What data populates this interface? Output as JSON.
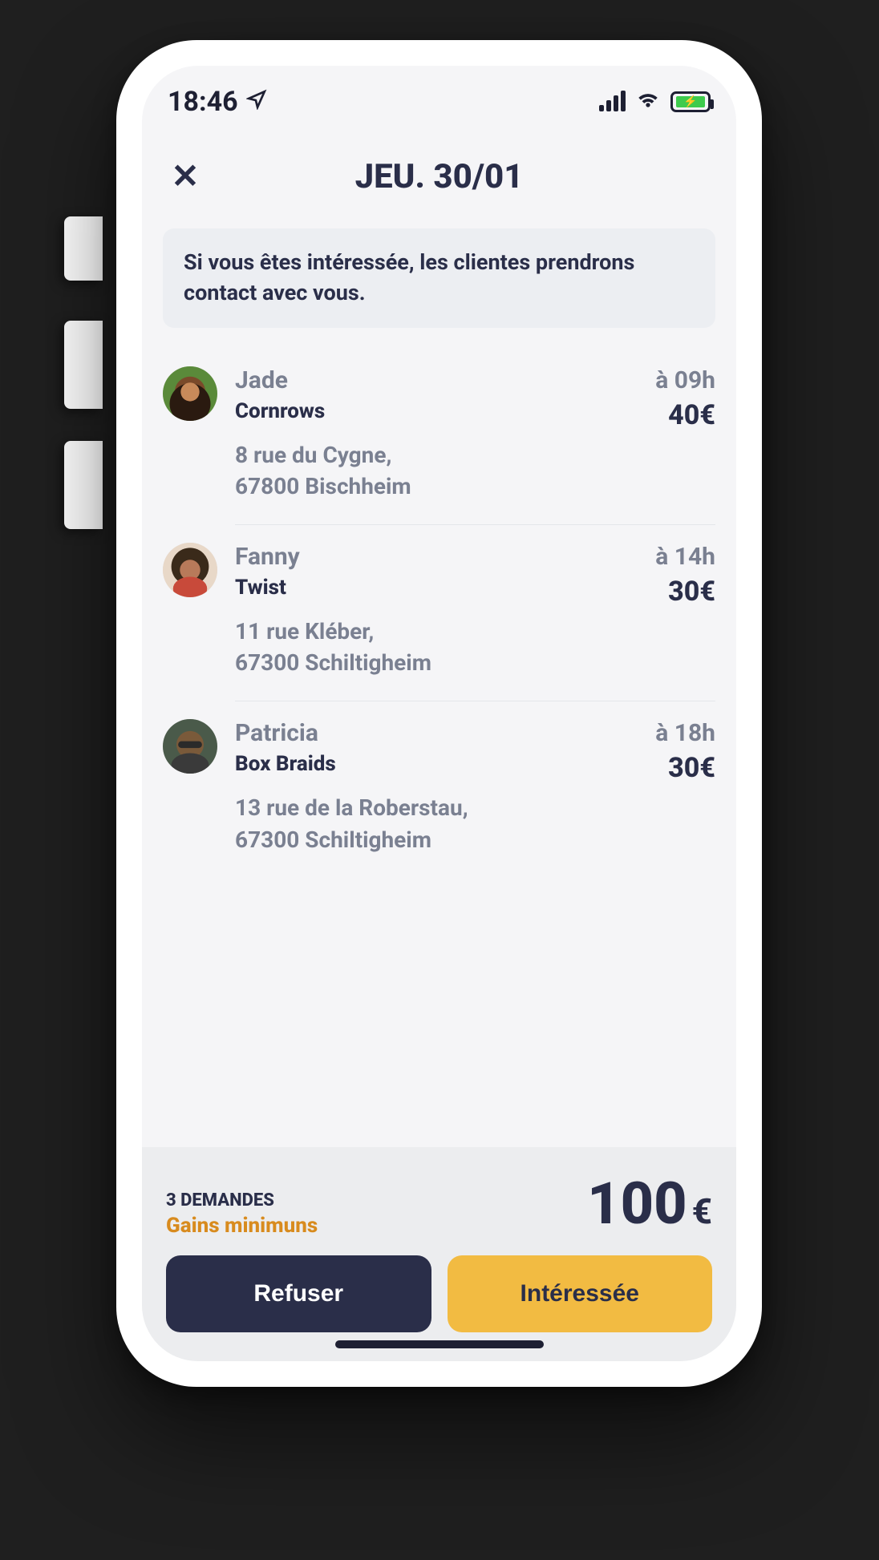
{
  "status": {
    "time": "18:46"
  },
  "header": {
    "title": "JEU. 30/01"
  },
  "info": {
    "text": "Si vous êtes intéressée, les clientes prendrons contact avec vous."
  },
  "list": [
    {
      "name": "Jade",
      "time": "à 09h",
      "service": "Cornrows",
      "price": "40€",
      "addr1": "8 rue du Cygne,",
      "addr2": "67800 Bischheim"
    },
    {
      "name": "Fanny",
      "time": "à 14h",
      "service": "Twist",
      "price": "30€",
      "addr1": "11 rue Kléber,",
      "addr2": "67300 Schiltigheim"
    },
    {
      "name": "Patricia",
      "time": "à 18h",
      "service": "Box Braids",
      "price": "30€",
      "addr1": "13 rue de la Roberstau,",
      "addr2": "67300 Schiltigheim"
    }
  ],
  "footer": {
    "count": "3 DEMANDES",
    "gains": "Gains minimuns",
    "total": "100",
    "currency": "€",
    "refuse": "Refuser",
    "accept": "Intéressée"
  }
}
